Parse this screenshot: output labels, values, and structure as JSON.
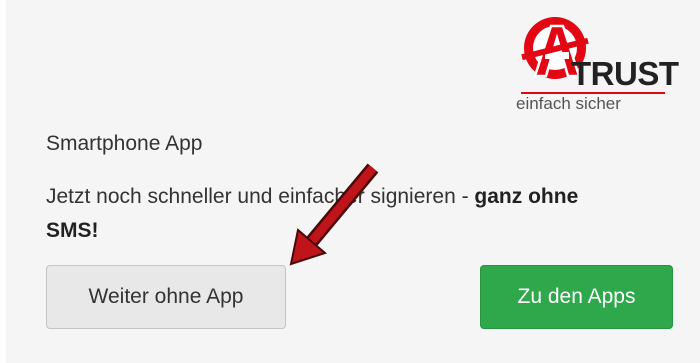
{
  "logo": {
    "word": "TRUST",
    "tagline": "einfach sicher",
    "brand_color": "#e30613"
  },
  "card": {
    "heading": "Smartphone App",
    "message_text": "Jetzt noch schneller und einfacher signieren - ",
    "message_bold": "ganz ohne SMS!"
  },
  "buttons": {
    "continue_without_app": "Weiter ohne App",
    "to_apps": "Zu den Apps"
  },
  "colors": {
    "panel_background": "#f5f5f5",
    "primary_button": "#2ea84a",
    "secondary_button": "#e8e8e8",
    "annotation_arrow": "#c0141b"
  },
  "annotation": {
    "arrow_icon": "red-arrow-pointing-down-left"
  }
}
